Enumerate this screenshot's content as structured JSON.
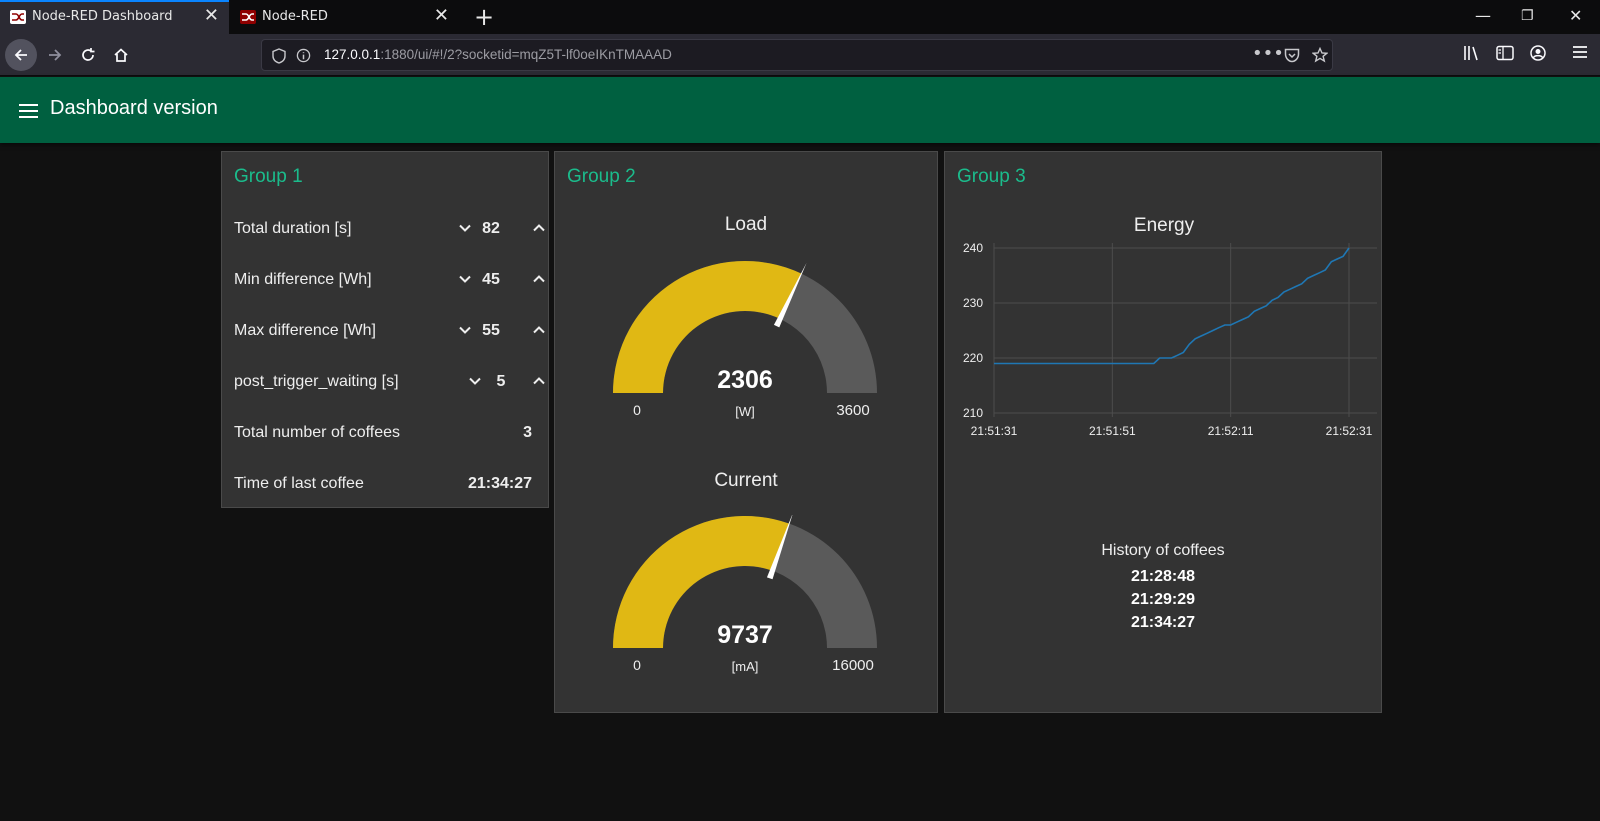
{
  "browser": {
    "tabs": [
      {
        "label": "Node-RED Dashboard",
        "active": true
      },
      {
        "label": "Node-RED",
        "active": false
      }
    ],
    "url_host": "127.0.0.1",
    "url_rest": ":1880/ui/#!/2?socketid=mqZ5T-lf0oeIKnTMAAAD"
  },
  "header": {
    "title": "Dashboard version"
  },
  "group1": {
    "title": "Group 1",
    "numerics": [
      {
        "label": "Total duration [s]",
        "value": "82"
      },
      {
        "label": "Min difference [Wh]",
        "value": "45"
      },
      {
        "label": "Max difference [Wh]",
        "value": "55"
      },
      {
        "label": "post_trigger_waiting [s]",
        "value": "5"
      }
    ],
    "texts": [
      {
        "label": "Total number of coffees",
        "value": "3"
      },
      {
        "label": "Time of last coffee",
        "value": "21:34:27"
      }
    ]
  },
  "group2": {
    "title": "Group 2",
    "gauges": [
      {
        "title": "Load",
        "value": "2306",
        "units": "[W]",
        "min": "0",
        "max": "3600",
        "fraction": 0.6406
      },
      {
        "title": "Current",
        "value": "9737",
        "units": "[mA]",
        "min": "0",
        "max": "16000",
        "fraction": 0.6086
      }
    ],
    "colors": {
      "fill": "#e0b814",
      "track": "#5a5a5a",
      "needle": "#ffffff"
    }
  },
  "group3": {
    "title": "Group 3",
    "history_title": "History of coffees",
    "history": [
      "21:28:48",
      "21:29:29",
      "21:34:27"
    ]
  },
  "chart_data": {
    "type": "line",
    "title": "Energy",
    "xlabel": "",
    "ylabel": "",
    "ylim": [
      210,
      240
    ],
    "x_tick_labels": [
      "21:51:31",
      "21:51:51",
      "21:52:11",
      "21:52:31"
    ],
    "y_tick_labels": [
      "210",
      "220",
      "230",
      "240"
    ],
    "x_range_seconds": [
      0,
      60
    ],
    "series": [
      {
        "color": "#1f77b4",
        "points": [
          [
            0,
            219
          ],
          [
            27,
            219
          ],
          [
            28,
            220
          ],
          [
            30,
            220
          ],
          [
            31,
            220.5
          ],
          [
            32,
            221
          ],
          [
            33,
            222.5
          ],
          [
            34,
            223.5
          ],
          [
            35,
            224
          ],
          [
            36,
            224.5
          ],
          [
            37,
            225
          ],
          [
            38,
            225.5
          ],
          [
            39,
            226
          ],
          [
            40,
            226
          ],
          [
            41,
            226.5
          ],
          [
            42,
            227
          ],
          [
            43,
            227.5
          ],
          [
            44,
            228.5
          ],
          [
            45,
            229
          ],
          [
            46,
            229.5
          ],
          [
            47,
            230.5
          ],
          [
            48,
            231
          ],
          [
            49,
            232
          ],
          [
            50,
            232.5
          ],
          [
            51,
            233
          ],
          [
            52,
            233.5
          ],
          [
            53,
            234.5
          ],
          [
            54,
            235
          ],
          [
            55,
            235.5
          ],
          [
            56,
            236
          ],
          [
            57,
            237.5
          ],
          [
            58,
            238
          ],
          [
            59,
            238.5
          ],
          [
            60,
            240
          ]
        ]
      }
    ],
    "grid": true
  }
}
